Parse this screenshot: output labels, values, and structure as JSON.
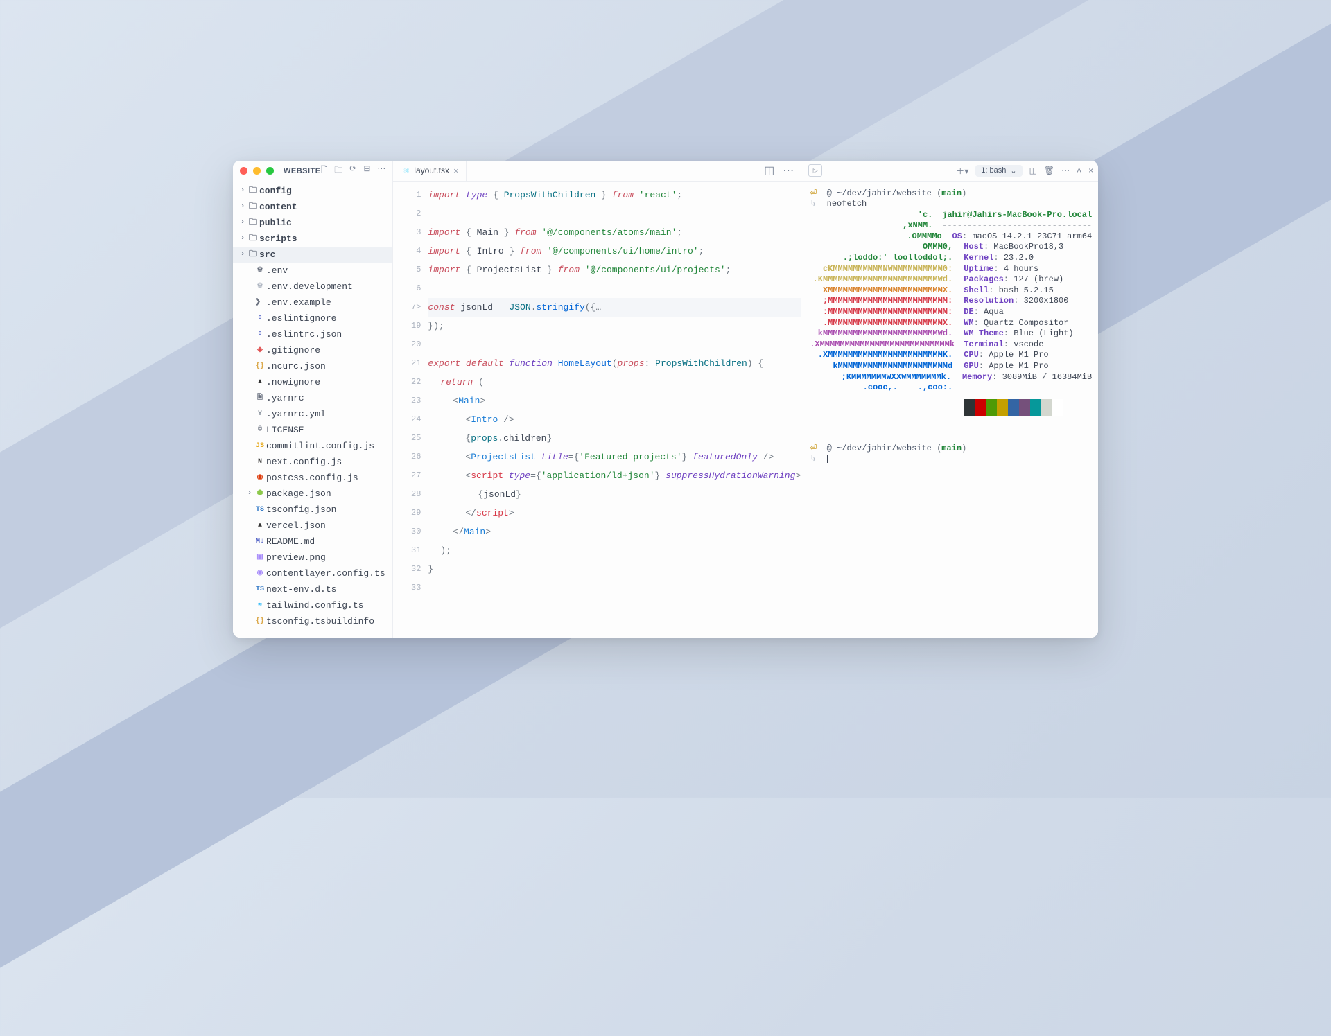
{
  "window": {
    "title": "WEBSITE"
  },
  "explorer": {
    "folders": [
      {
        "name": "config",
        "expanded": false
      },
      {
        "name": "content",
        "expanded": false
      },
      {
        "name": "public",
        "expanded": false
      },
      {
        "name": "scripts",
        "expanded": false
      },
      {
        "name": "src",
        "expanded": false,
        "selected": true
      }
    ],
    "files": [
      {
        "name": ".env",
        "icon": "⚙",
        "color": "#6b7280"
      },
      {
        "name": ".env.development",
        "icon": "⚙",
        "color": "#b0b7c3"
      },
      {
        "name": ".env.example",
        "icon": "❯_",
        "color": "#6b7280"
      },
      {
        "name": ".eslintignore",
        "icon": "◊",
        "color": "#4b5cc4"
      },
      {
        "name": ".eslintrc.json",
        "icon": "◊",
        "color": "#4b5cc4"
      },
      {
        "name": ".gitignore",
        "icon": "◈",
        "color": "#e05252"
      },
      {
        "name": ".ncurc.json",
        "icon": "{}",
        "color": "#d9a441"
      },
      {
        "name": ".nowignore",
        "icon": "▲",
        "color": "#333"
      },
      {
        "name": ".yarnrc",
        "icon": "🗎",
        "color": "#6b7280"
      },
      {
        "name": ".yarnrc.yml",
        "icon": "Y",
        "color": "#8a939e"
      },
      {
        "name": "LICENSE",
        "icon": "©",
        "color": "#6b7280"
      },
      {
        "name": "commitlint.config.js",
        "icon": "JS",
        "color": "#e6a817"
      },
      {
        "name": "next.config.js",
        "icon": "N",
        "color": "#333"
      },
      {
        "name": "postcss.config.js",
        "icon": "◉",
        "color": "#dd3a0a"
      },
      {
        "name": "package.json",
        "icon": "⬢",
        "color": "#8cc84b",
        "chev": true
      },
      {
        "name": "tsconfig.json",
        "icon": "TS",
        "color": "#3178c6"
      },
      {
        "name": "vercel.json",
        "icon": "▲",
        "color": "#333"
      },
      {
        "name": "README.md",
        "icon": "M↓",
        "color": "#4b5cc4"
      },
      {
        "name": "preview.png",
        "icon": "▣",
        "color": "#a78bfa"
      },
      {
        "name": "contentlayer.config.ts",
        "icon": "◉",
        "color": "#a78bfa"
      },
      {
        "name": "next-env.d.ts",
        "icon": "TS",
        "color": "#3178c6"
      },
      {
        "name": "tailwind.config.ts",
        "icon": "≈",
        "color": "#38bdf8"
      },
      {
        "name": "tsconfig.tsbuildinfo",
        "icon": "{}",
        "color": "#d9a441"
      }
    ]
  },
  "tab": {
    "filename": "layout.tsx"
  },
  "lineNumbers": [
    "1",
    "2",
    "3",
    "4",
    "5",
    "6",
    "7",
    "19",
    "20",
    "21",
    "22",
    "23",
    "24",
    "25",
    "26",
    "27",
    "28",
    "29",
    "30",
    "31",
    "32",
    "33"
  ],
  "lineFolds": {
    "6": ">"
  },
  "code": {
    "kw_import": "import",
    "kw_type": "type",
    "kw_from": "from",
    "kw_export": "export",
    "kw_default": "default",
    "kw_function": "function",
    "kw_return": "return",
    "kw_const": "const",
    "PropsWithChildren": "PropsWithChildren",
    "react": "'react'",
    "Main": "Main",
    "main_path": "'@/components/atoms/main'",
    "Intro": "Intro",
    "intro_path": "'@/components/ui/home/intro'",
    "ProjectsList": "ProjectsList",
    "proj_path": "'@/components/ui/projects'",
    "jsonLd": "jsonLd",
    "JSON": "JSON",
    "stringify": "stringify",
    "HomeLayout": "HomeLayout",
    "props": "props",
    "title_attr": "title",
    "featured_str": "'Featured projects'",
    "featuredOnly": "featuredOnly",
    "script_tag": "script",
    "type_attr": "type",
    "ldjson": "'application/ld+json'",
    "suppress": "suppressHydrationWarning",
    "children": "children"
  },
  "terminal": {
    "dropdown": "1: bash",
    "prompt_at": "@",
    "prompt_path": "~/dev/jahir/website",
    "prompt_branch": "main",
    "command": "neofetch",
    "ascii": [
      {
        "t": "'c.",
        "c": "#22863a"
      },
      {
        "t": ",xNMM.",
        "c": "#22863a"
      },
      {
        "t": ".OMMMMo",
        "c": "#22863a"
      },
      {
        "t": "OMMM0,",
        "c": "#22863a"
      },
      {
        "t": ".;loddo:' loolloddol;.",
        "c": "#22863a"
      },
      {
        "t": "cKMMMMMMMMMMNWMMMMMMMMMM0:",
        "c": "#c9b458"
      },
      {
        "t": ".KMMMMMMMMMMMMMMMMMMMMMMMWd.",
        "c": "#c9b458"
      },
      {
        "t": "XMMMMMMMMMMMMMMMMMMMMMMMX.",
        "c": "#d9822b"
      },
      {
        "t": ";MMMMMMMMMMMMMMMMMMMMMMMM:",
        "c": "#d73a49"
      },
      {
        "t": ":MMMMMMMMMMMMMMMMMMMMMMMM:",
        "c": "#d73a49"
      },
      {
        "t": ".MMMMMMMMMMMMMMMMMMMMMMMX.",
        "c": "#d73a49"
      },
      {
        "t": "kMMMMMMMMMMMMMMMMMMMMMMMWd.",
        "c": "#a94caf"
      },
      {
        "t": ".XMMMMMMMMMMMMMMMMMMMMMMMMMMk",
        "c": "#a94caf"
      },
      {
        "t": ".XMMMMMMMMMMMMMMMMMMMMMMMK.",
        "c": "#0366d6"
      },
      {
        "t": "kMMMMMMMMMMMMMMMMMMMMMMd",
        "c": "#0366d6"
      },
      {
        "t": ";KMMMMMMMWXXWMMMMMMMk.",
        "c": "#0366d6"
      },
      {
        "t": ".cooc,.    .,coo:.",
        "c": "#0366d6"
      }
    ],
    "userhost": "jahir@Jahirs-MacBook-Pro.local",
    "divider": "------------------------------",
    "info": [
      {
        "label": "OS",
        "value": "macOS 14.2.1 23C71 arm64"
      },
      {
        "label": "Host",
        "value": "MacBookPro18,3"
      },
      {
        "label": "Kernel",
        "value": "23.2.0"
      },
      {
        "label": "Uptime",
        "value": "4 hours"
      },
      {
        "label": "Packages",
        "value": "127 (brew)"
      },
      {
        "label": "Shell",
        "value": "bash 5.2.15"
      },
      {
        "label": "Resolution",
        "value": "3200x1800"
      },
      {
        "label": "DE",
        "value": "Aqua"
      },
      {
        "label": "WM",
        "value": "Quartz Compositor"
      },
      {
        "label": "WM Theme",
        "value": "Blue (Light)"
      },
      {
        "label": "Terminal",
        "value": "vscode"
      },
      {
        "label": "CPU",
        "value": "Apple M1 Pro"
      },
      {
        "label": "GPU",
        "value": "Apple M1 Pro"
      },
      {
        "label": "Memory",
        "value": "3089MiB / 16384MiB"
      }
    ],
    "colorbar": [
      "#2e3436",
      "#cc0000",
      "#4e9a06",
      "#c4a000",
      "#3465a4",
      "#75507b",
      "#06989a",
      "#d3d7cf",
      "#ffffff"
    ]
  }
}
